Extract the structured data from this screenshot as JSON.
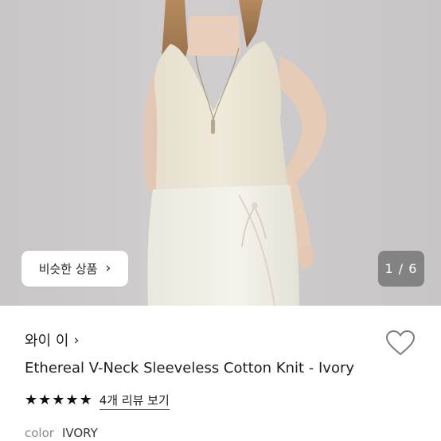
{
  "hero": {
    "similar_button_label": "비슷한 상품",
    "similar_button_icon": "chevron-right-icon",
    "image_counter": "1 / 6"
  },
  "product": {
    "brand": "와이 이",
    "brand_icon": "chevron-right-icon",
    "title": "Ethereal V-Neck Sleeveless Cotton Knit - Ivory",
    "wishlist_icon": "heart-outline-icon",
    "rating_stars": 5,
    "reviews_link": "4개 리뷰 보기",
    "color_label": "color",
    "color_value": "IVORY"
  }
}
